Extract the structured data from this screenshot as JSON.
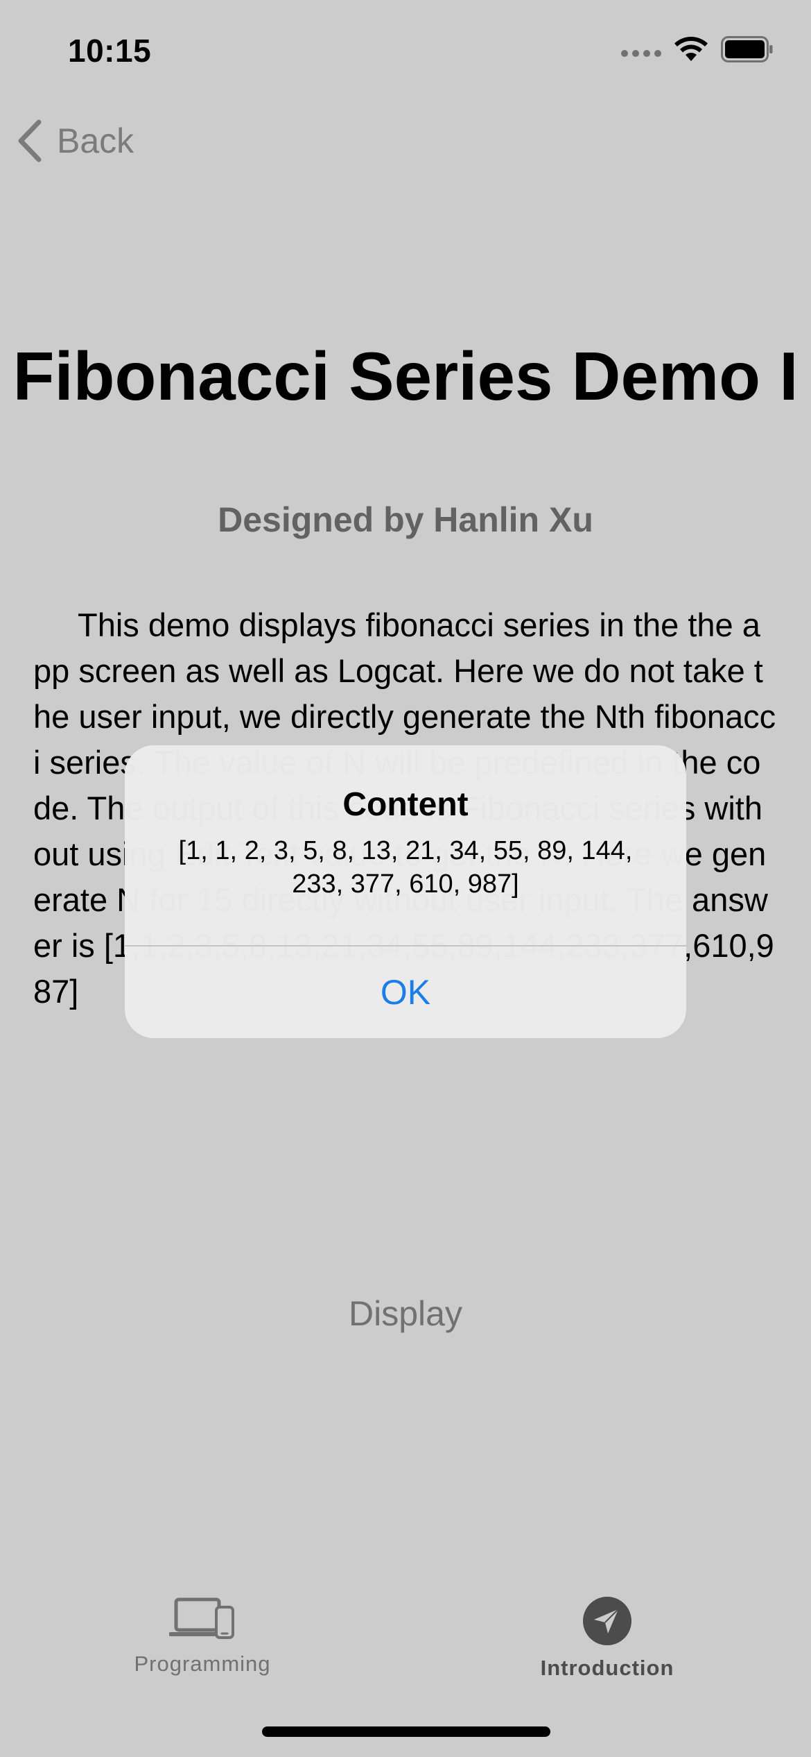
{
  "status_bar": {
    "time": "10:15"
  },
  "nav": {
    "back_label": "Back"
  },
  "page": {
    "title": "Fibonacci Series Demo I",
    "subtitle": "Designed by Hanlin Xu",
    "description": "This demo displays fibonacci series in the the app screen as well as Logcat. Here we do not take the user input, we directly generate the Nth fibonacci series. The value of N will be predefined in the code. The output of this code is Fibonacci series without using Edit Text value to get the N. Here we generate N for 15 directly without user input. The answer is [1,1,2,3,5,8,13,21,34,55,89,144,233,377,610,987]",
    "display_button_label": "Display"
  },
  "tab_bar": {
    "items": [
      {
        "label": "Programming",
        "icon": "laptop-phone-icon",
        "selected": false
      },
      {
        "label": "Introduction",
        "icon": "paper-plane-icon",
        "selected": true
      }
    ]
  },
  "alert": {
    "title": "Content",
    "message": "[1, 1, 2, 3, 5, 8, 13, 21, 34, 55, 89, 144, 233, 377, 610, 987]",
    "ok_label": "OK"
  },
  "colors": {
    "accent": "#1a7ee6",
    "secondary_text": "#8e8e8e",
    "overlay": "rgba(0,0,0,0.2)"
  }
}
